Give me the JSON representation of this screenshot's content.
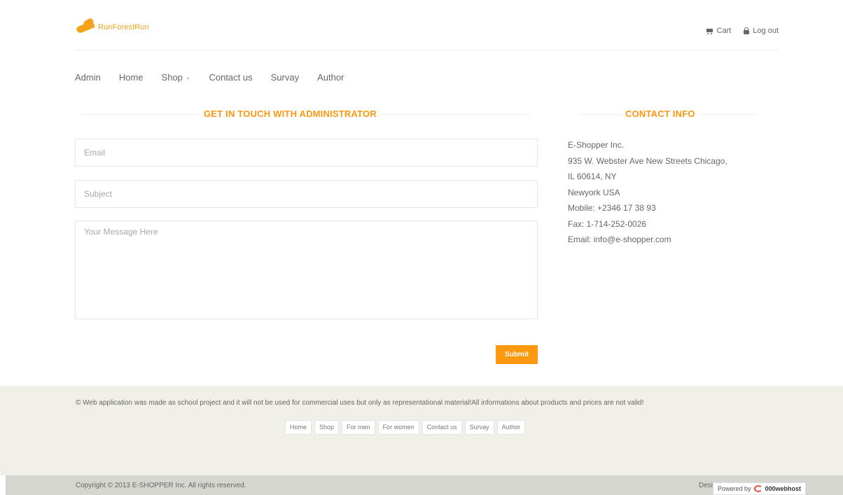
{
  "header": {
    "logo_text": "RunForestRun",
    "cart_label": "Cart",
    "logout_label": "Log out"
  },
  "menu": {
    "items": [
      "Admin",
      "Home",
      "Shop",
      "Contact us",
      "Survay",
      "Author"
    ]
  },
  "form": {
    "title": "GET IN TOUCH WITH ADMINISTRATOR",
    "email_placeholder": "Email",
    "subject_placeholder": "Subject",
    "message_placeholder": "Your Message Here",
    "submit_label": "Submit"
  },
  "contact": {
    "title": "CONTACT INFO",
    "company": "E-Shopper Inc.",
    "address_line1": "935 W. Webster Ave New Streets Chicago,",
    "address_line2": "IL 60614, NY",
    "address_line3": "Newyork USA",
    "mobile": "Mobile: +2346 17 38 93",
    "fax": "Fax: 1-714-252-0026",
    "email": "Email: info@e-shopper.com"
  },
  "footer": {
    "note": "© Web application was made as school project and it will not be used for commercial uses but only as representational material!All informations about products and prices are not valid!",
    "nav": [
      "Home",
      "Shop",
      "For men",
      "For women",
      "Contact us",
      "Survay",
      "Author"
    ],
    "copyright": "Copyright © 2013 E-SHOPPER Inc. All rights reserved.",
    "designed": "Desi",
    "powered_by": "Powered by",
    "host_name": "000webhost"
  },
  "colors": {
    "accent": "#fe980f",
    "footer_bg": "#f0f0e9",
    "bottom_bg": "#d6d6d0"
  }
}
